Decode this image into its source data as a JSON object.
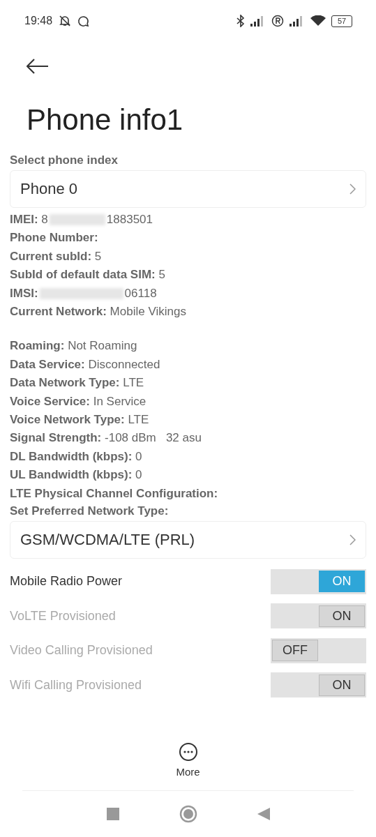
{
  "status_bar": {
    "time": "19:48",
    "battery": "57"
  },
  "title": "Phone info1",
  "phone_index": {
    "label": "Select phone index",
    "value": "Phone 0"
  },
  "info_group_1": [
    {
      "label": "IMEI:",
      "value_start": "8",
      "value": "1883501",
      "redacted": true
    },
    {
      "label": "Phone Number:"
    },
    {
      "label": "Current subId:",
      "value": "5"
    },
    {
      "label": "SubId of default data SIM:",
      "value": "5"
    },
    {
      "label": "IMSI:",
      "value": "06118",
      "redacted": true
    },
    {
      "label": "Current Network:",
      "value": "Mobile Vikings"
    }
  ],
  "info_group_2": [
    {
      "label": "Roaming:",
      "value": "Not Roaming"
    },
    {
      "label": "Data Service:",
      "value": "Disconnected"
    },
    {
      "label": "Data Network Type:",
      "value": "LTE"
    },
    {
      "label": "Voice Service:",
      "value": "In Service"
    },
    {
      "label": "Voice Network Type:",
      "value": "LTE"
    },
    {
      "label": "Signal Strength:",
      "value": "-108 dBm   32 asu"
    },
    {
      "label": "DL Bandwidth (kbps):",
      "value": "0"
    },
    {
      "label": "UL Bandwidth (kbps):",
      "value": "0"
    },
    {
      "label": "LTE Physical Channel Configuration:"
    }
  ],
  "network_type": {
    "label": "Set Preferred Network Type:",
    "value": "GSM/WCDMA/LTE (PRL)"
  },
  "toggles": [
    {
      "label": "Mobile Radio Power",
      "on": true,
      "enabled": true,
      "state_text": "ON"
    },
    {
      "label": "VoLTE Provisioned",
      "on": true,
      "enabled": false,
      "state_text": "ON"
    },
    {
      "label": "Video Calling Provisioned",
      "on": false,
      "enabled": false,
      "state_text": "OFF"
    },
    {
      "label": "Wifi Calling Provisioned",
      "on": true,
      "enabled": false,
      "state_text": "ON"
    }
  ],
  "bottom_action": {
    "label": "More"
  }
}
